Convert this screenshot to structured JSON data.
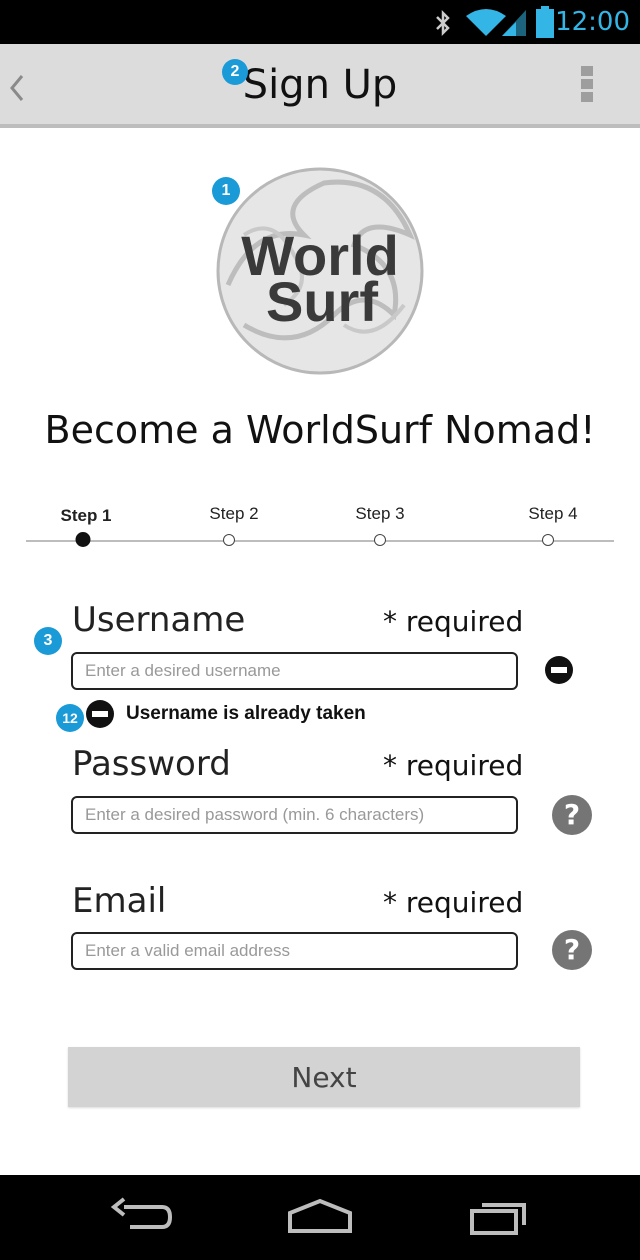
{
  "status_bar": {
    "time": "12:00",
    "icons": [
      "bluetooth-icon",
      "wifi-icon",
      "signal-icon",
      "battery-icon"
    ],
    "accent_color": "#33b5e5"
  },
  "action_bar": {
    "title": "Sign Up",
    "back_icon": "chevron-left-icon",
    "menu_icon": "overflow-menu-icon"
  },
  "callouts": {
    "logo": "1",
    "title": "2",
    "username": "3",
    "error": "12",
    "color": "#1a9ad6"
  },
  "logo": {
    "line1": "World",
    "line2": "Surf"
  },
  "headline": "Become a WorldSurf Nomad!",
  "steps": {
    "items": [
      {
        "label": "Step 1",
        "active": true
      },
      {
        "label": "Step 2",
        "active": false
      },
      {
        "label": "Step 3",
        "active": false
      },
      {
        "label": "Step 4",
        "active": false
      }
    ]
  },
  "form": {
    "username": {
      "label": "Username",
      "required": "* required",
      "placeholder": "Enter a desired username",
      "value": "",
      "status_icon": "error-minus-icon"
    },
    "username_error": "Username is already taken",
    "password": {
      "label": "Password",
      "required": "* required",
      "placeholder": "Enter a desired password (min. 6 characters)",
      "value": "",
      "help_icon": "help-icon",
      "help_glyph": "?"
    },
    "email": {
      "label": "Email",
      "required": "* required",
      "placeholder": "Enter a valid email address",
      "value": "",
      "help_icon": "help-icon",
      "help_glyph": "?"
    }
  },
  "next_button": "Next",
  "nav_bar": {
    "icons": [
      "back-icon",
      "home-icon",
      "recents-icon"
    ]
  }
}
